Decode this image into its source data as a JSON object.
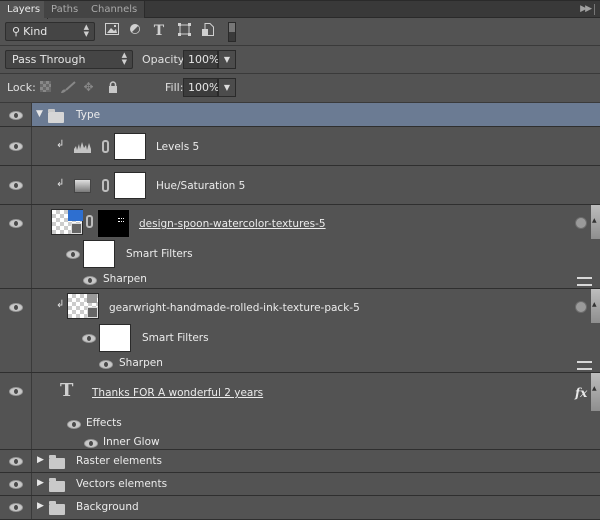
{
  "tabs": [
    {
      "label": "Layers",
      "active": true
    },
    {
      "label": "Paths",
      "active": false
    },
    {
      "label": "Channels",
      "active": false
    }
  ],
  "filter": {
    "kind_label": "Kind",
    "icons": [
      "pixel-filter-icon",
      "adjustment-filter-icon",
      "type-filter-icon",
      "shape-filter-icon",
      "smart-object-filter-icon",
      "filter-toggle-switch"
    ]
  },
  "blend": {
    "mode": "Pass Through",
    "opacity_label": "Opacity:",
    "opacity_value": "100%",
    "lock_label": "Lock:",
    "fill_label": "Fill:",
    "fill_value": "100%"
  },
  "layers": [
    {
      "name": "Type",
      "kind": "group",
      "expanded": true,
      "selected": true
    },
    {
      "name": "Levels 5",
      "kind": "adjustment-levels",
      "clipped": true
    },
    {
      "name": "Hue/Saturation 5",
      "kind": "adjustment-hue-saturation",
      "clipped": true
    },
    {
      "name": "design-spoon-watercolor-textures-5",
      "kind": "smart-object",
      "masked": true,
      "smart_filters_label": "Smart Filters",
      "filters": [
        "Sharpen"
      ]
    },
    {
      "name": "gearwright-handmade-rolled-ink-texture-pack-5",
      "kind": "smart-object",
      "clipped": true,
      "smart_filters_label": "Smart Filters",
      "filters": [
        "Sharpen"
      ]
    },
    {
      "name": "Thanks FOR A wonderful 2 years",
      "kind": "type",
      "effects_label": "Effects",
      "effects": [
        "Inner Glow"
      ],
      "fx_label": "fx"
    },
    {
      "name": "Raster elements",
      "kind": "group",
      "expanded": false
    },
    {
      "name": "Vectors elements",
      "kind": "group",
      "expanded": false
    },
    {
      "name": "Background",
      "kind": "group",
      "expanded": false
    }
  ],
  "colors": {
    "panel_bg": "#535353",
    "selected_row": "#6b7b93",
    "tab_bar": "#393939"
  }
}
